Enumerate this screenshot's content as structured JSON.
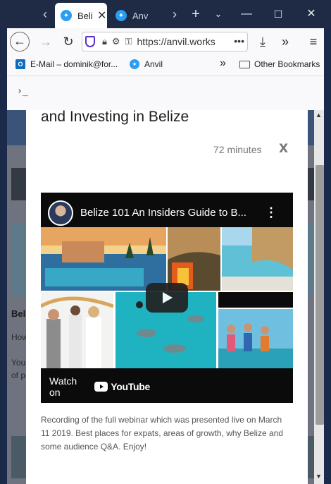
{
  "browser": {
    "tabs": [
      {
        "title": "Belize",
        "active": true
      },
      {
        "title": "Anvil",
        "active": false
      }
    ],
    "url": "https://anvil.works",
    "bookmarks": [
      {
        "label": "E-Mail – dominik@for...",
        "icon": "outlook-icon"
      },
      {
        "label": "Anvil",
        "icon": "anvil-icon"
      }
    ],
    "other_bookmarks": "Other Bookmarks",
    "console_prompt": "›_",
    "colors": {
      "tab_favicon": "#2a9df4",
      "shield": "#5b2fd0"
    }
  },
  "background_page": {
    "bold_text": "Beli",
    "line1": "How",
    "line2": "You",
    "line3": "of p"
  },
  "modal": {
    "title": "and Investing in Belize",
    "duration": "72 minutes",
    "close_label": "X",
    "video": {
      "title": "Belize 101 An Insiders Guide to B...",
      "watch_on": "Watch on",
      "youtube": "YouTube"
    },
    "description": "Recording of the full webinar which was presented live on March 11 2019. Best places for expats, areas of growth, why Belize and some audience Q&A. Enjoy!"
  }
}
